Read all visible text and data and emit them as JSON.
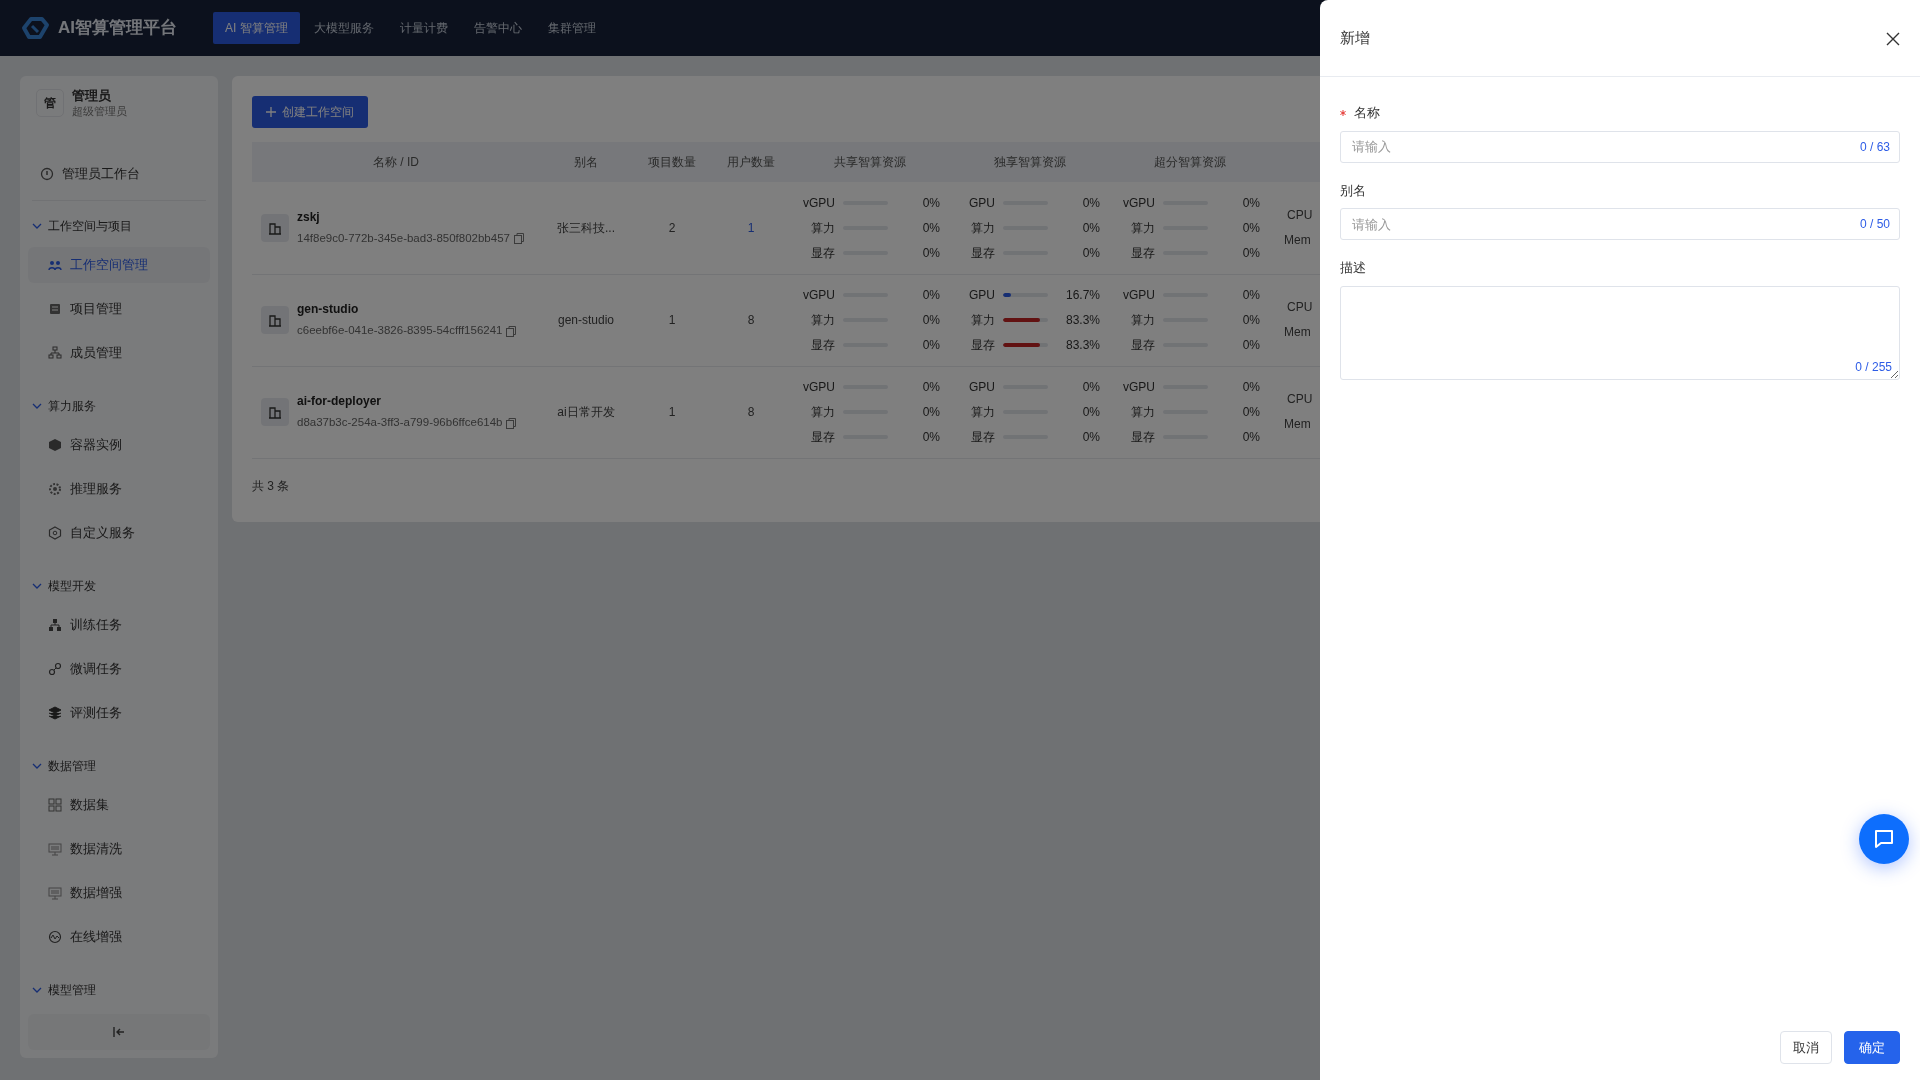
{
  "header": {
    "logo": "AI智算管理平台",
    "nav": [
      {
        "label": "AI 智算管理",
        "selected": true
      },
      {
        "label": "大模型服务",
        "selected": false
      },
      {
        "label": "计量计费",
        "selected": false
      },
      {
        "label": "告警中心",
        "selected": false
      },
      {
        "label": "集群管理",
        "selected": false
      }
    ]
  },
  "sidebar": {
    "user": {
      "avatar": "管",
      "name": "管理员",
      "role": "超级管理员"
    },
    "top_item": {
      "label": "管理员工作台",
      "selected": false
    },
    "groups": [
      {
        "label": "工作空间与项目",
        "expanded": true,
        "items": [
          {
            "label": "工作空间管理",
            "selected": true
          },
          {
            "label": "项目管理",
            "selected": false
          },
          {
            "label": "成员管理",
            "selected": false
          }
        ]
      },
      {
        "label": "算力服务",
        "expanded": true,
        "items": [
          {
            "label": "容器实例",
            "selected": false
          },
          {
            "label": "推理服务",
            "selected": false
          },
          {
            "label": "自定义服务",
            "selected": false
          }
        ]
      },
      {
        "label": "模型开发",
        "expanded": true,
        "items": [
          {
            "label": "训练任务",
            "selected": false
          },
          {
            "label": "微调任务",
            "selected": false
          },
          {
            "label": "评测任务",
            "selected": false
          }
        ]
      },
      {
        "label": "数据管理",
        "expanded": true,
        "items": [
          {
            "label": "数据集",
            "selected": false
          },
          {
            "label": "数据清洗",
            "selected": false
          },
          {
            "label": "数据增强",
            "selected": false
          },
          {
            "label": "在线增强",
            "selected": false
          }
        ]
      },
      {
        "label": "模型管理",
        "expanded": true
      }
    ]
  },
  "content": {
    "create_button": "创建工作空间",
    "table": {
      "columns": [
        "名称 / ID",
        "别名",
        "项目数量",
        "用户数量",
        "共享智算资源",
        "独享智算资源",
        "超分智算资源"
      ],
      "rows": [
        {
          "name": "zskj",
          "id": "14f8e9c0-772b-345e-bad3-850f802bb457",
          "alias": "张三科技...",
          "projects": "2",
          "users": "1",
          "users_linked": true,
          "shared": [
            {
              "label": "vGPU",
              "level": 0,
              "reading": "0%"
            },
            {
              "label": "算力",
              "level": 0,
              "reading": "0%"
            },
            {
              "label": "显存",
              "level": 0,
              "reading": "0%"
            }
          ],
          "exclusive": [
            {
              "label": "GPU",
              "level": 0,
              "reading": "0%"
            },
            {
              "label": "算力",
              "level": 0,
              "reading": "0%"
            },
            {
              "label": "显存",
              "level": 0,
              "reading": "0%"
            }
          ],
          "oversold": [
            {
              "label": "vGPU",
              "level": 0,
              "reading": "0%"
            },
            {
              "label": "算力",
              "level": 0,
              "reading": "0%"
            },
            {
              "label": "显存",
              "level": 0,
              "reading": "0%"
            }
          ],
          "column_8": [
            "CPU",
            "Mem"
          ]
        },
        {
          "name": "gen-studio",
          "id": "c6eebf6e-041e-3826-8395-54cfff156241",
          "alias": "gen-studio",
          "projects": "1",
          "users": "8",
          "users_linked": false,
          "shared": [
            {
              "label": "vGPU",
              "level": 0,
              "reading": "0%"
            },
            {
              "label": "算力",
              "level": 0,
              "reading": "0%"
            },
            {
              "label": "显存",
              "level": 0,
              "reading": "0%"
            }
          ],
          "exclusive": [
            {
              "label": "GPU",
              "level": 0.167,
              "reading": "16.7%"
            },
            {
              "label": "算力",
              "level": 0.833,
              "reading": "83.3%"
            },
            {
              "label": "显存",
              "level": 0.833,
              "reading": "83.3%"
            }
          ],
          "oversold": [
            {
              "label": "vGPU",
              "level": 0,
              "reading": "0%"
            },
            {
              "label": "算力",
              "level": 0,
              "reading": "0%"
            },
            {
              "label": "显存",
              "level": 0,
              "reading": "0%"
            }
          ],
          "column_8": [
            "CPU",
            "Mem"
          ]
        },
        {
          "name": "ai-for-deployer",
          "id": "d8a37b3c-254a-3ff3-a799-96b6ffce614b",
          "alias": "ai日常开发",
          "projects": "1",
          "users": "8",
          "users_linked": false,
          "shared": [
            {
              "label": "vGPU",
              "level": 0,
              "reading": "0%"
            },
            {
              "label": "算力",
              "level": 0,
              "reading": "0%"
            },
            {
              "label": "显存",
              "level": 0,
              "reading": "0%"
            }
          ],
          "exclusive": [
            {
              "label": "GPU",
              "level": 0,
              "reading": "0%"
            },
            {
              "label": "算力",
              "level": 0,
              "reading": "0%"
            },
            {
              "label": "显存",
              "level": 0,
              "reading": "0%"
            }
          ],
          "oversold": [
            {
              "label": "vGPU",
              "level": 0,
              "reading": "0%"
            },
            {
              "label": "算力",
              "level": 0,
              "reading": "0%"
            },
            {
              "label": "显存",
              "level": 0,
              "reading": "0%"
            }
          ],
          "column_8": [
            "CPU",
            "Mem"
          ]
        }
      ]
    },
    "total": "共 3 条"
  },
  "drawer": {
    "title": "新增",
    "fields": [
      {
        "kind": "input",
        "label": "名称",
        "required": true,
        "placeholder": "请输入",
        "counter": "0 / 63"
      },
      {
        "kind": "input",
        "label": "别名",
        "required": false,
        "placeholder": "请输入",
        "counter": "0 / 50"
      },
      {
        "kind": "textarea",
        "label": "描述",
        "required": false,
        "counter": "0 / 255"
      }
    ],
    "buttons": [
      {
        "kind": "cancel",
        "label": "取消"
      },
      {
        "kind": "primary",
        "label": "确定"
      }
    ]
  }
}
